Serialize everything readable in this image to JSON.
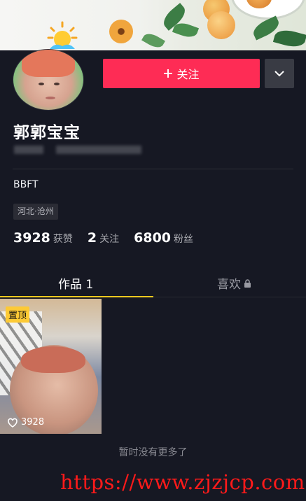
{
  "profile": {
    "name": "郭郭宝宝",
    "bio": "BBFT",
    "location": "河北·沧州"
  },
  "actions": {
    "follow_label": "关注",
    "follow_icon": "plus-icon",
    "more_icon": "chevron-down-icon"
  },
  "stats": [
    {
      "value": "3928",
      "label": "获赞"
    },
    {
      "value": "2",
      "label": "关注"
    },
    {
      "value": "6800",
      "label": "粉丝"
    }
  ],
  "tabs": {
    "works": "作品 1",
    "likes": "喜欢",
    "likes_icon": "lock-icon"
  },
  "videos": [
    {
      "pinned_label": "置顶",
      "likes": "3928",
      "likes_icon": "heart-icon"
    }
  ],
  "footer": {
    "end_text": "暂时没有更多了"
  },
  "watermark": "https://www.zjzjcp.com",
  "colors": {
    "background": "#161823",
    "follow_button": "#fe2c55",
    "tab_indicator": "#f0c81e",
    "pin_badge": "#fdca35"
  }
}
